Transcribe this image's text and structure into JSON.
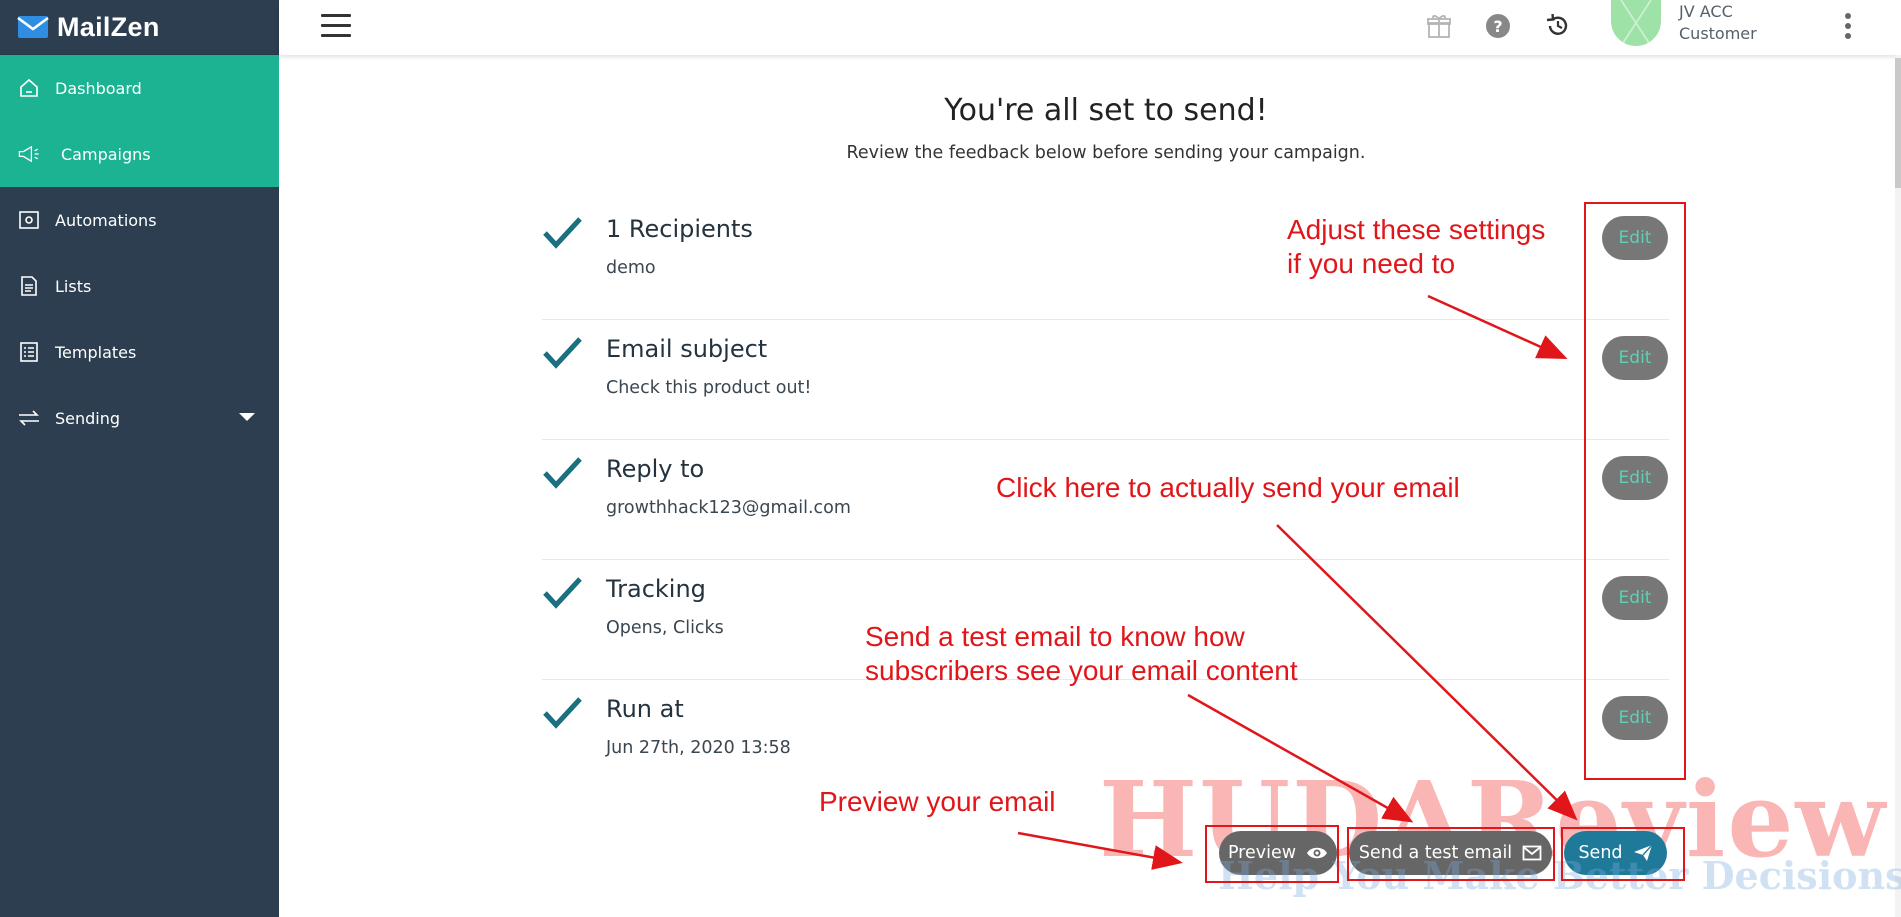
{
  "app": {
    "name": "MailZen"
  },
  "sidebar": {
    "items": [
      {
        "label": "Dashboard",
        "icon": "home-icon"
      },
      {
        "label": "Campaigns",
        "icon": "megaphone-icon"
      },
      {
        "label": "Automations",
        "icon": "automation-icon"
      },
      {
        "label": "Lists",
        "icon": "list-document-icon"
      },
      {
        "label": "Templates",
        "icon": "templates-icon"
      },
      {
        "label": "Sending",
        "icon": "transfer-arrows-icon"
      }
    ]
  },
  "topbar": {
    "icons": [
      "menu-icon",
      "gift-icon",
      "help-icon",
      "history-icon",
      "more-vertical-icon"
    ],
    "user": {
      "name": "JV ACC",
      "role": "Customer"
    }
  },
  "main": {
    "heading": "You're all set to send!",
    "subheading": "Review the feedback below before sending your campaign.",
    "rows": [
      {
        "title": "1 Recipients",
        "value": "demo",
        "edit_label": "Edit"
      },
      {
        "title": "Email subject",
        "value": "Check this product out!",
        "edit_label": "Edit"
      },
      {
        "title": "Reply to",
        "value": "growthhack123@gmail.com",
        "edit_label": "Edit"
      },
      {
        "title": "Tracking",
        "value": "Opens, Clicks",
        "edit_label": "Edit"
      },
      {
        "title": "Run at",
        "value": "Jun 27th, 2020 13:58",
        "edit_label": "Edit"
      }
    ],
    "buttons": {
      "preview": "Preview",
      "test": "Send a test email",
      "send": "Send"
    }
  },
  "annotations": {
    "adjust_line1": "Adjust these settings",
    "adjust_line2": "if you need to",
    "send_note": "Click here to actually send your email",
    "test_line1": "Send a test email to know how",
    "test_line2": "subscribers see your email content",
    "preview_note": "Preview your email"
  },
  "watermark": {
    "big": "HUDAReview",
    "small": "Help You Make Better Decisions"
  },
  "colors": {
    "sidebar_bg": "#2c3e50",
    "sidebar_active": "#1cb392",
    "check": "#1a6f80",
    "edit_button": "#777777",
    "send_button": "#1f7a9a",
    "annotation": "#e0161b"
  }
}
